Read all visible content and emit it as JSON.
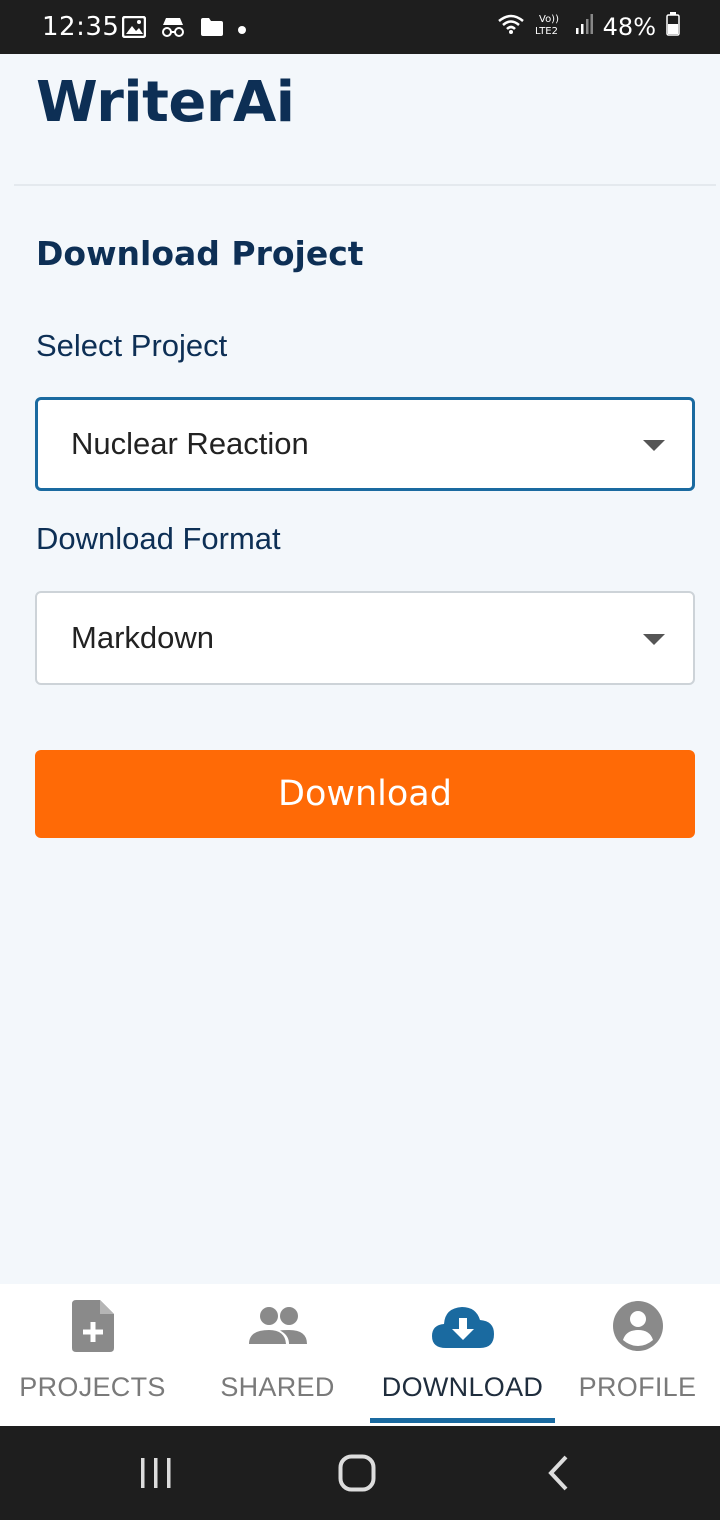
{
  "status_bar": {
    "time": "12:35",
    "battery": "48%",
    "icons_left": [
      "image-icon",
      "incognito-icon",
      "folder-icon",
      "dot-icon"
    ],
    "icons_right": [
      "wifi-icon",
      "volte-lte2-icon",
      "signal-icon",
      "battery-icon"
    ]
  },
  "header": {
    "title": "WriterAi"
  },
  "main": {
    "section_title": "Download Project",
    "project_label": "Select Project",
    "project_value": "Nuclear Reaction",
    "format_label": "Download Format",
    "format_value": "Markdown",
    "download_button": "Download"
  },
  "bottom_nav": {
    "items": [
      {
        "label": "PROJECTS",
        "icon": "add-document-icon",
        "active": false
      },
      {
        "label": "SHARED",
        "icon": "people-icon",
        "active": false
      },
      {
        "label": "DOWNLOAD",
        "icon": "cloud-download-icon",
        "active": true
      },
      {
        "label": "PROFILE",
        "icon": "account-circle-icon",
        "active": false
      }
    ]
  },
  "colors": {
    "brand_navy": "#0d2f55",
    "accent_blue": "#1a6aa0",
    "button_orange": "#ff6a06",
    "background": "#f3f7fb"
  }
}
